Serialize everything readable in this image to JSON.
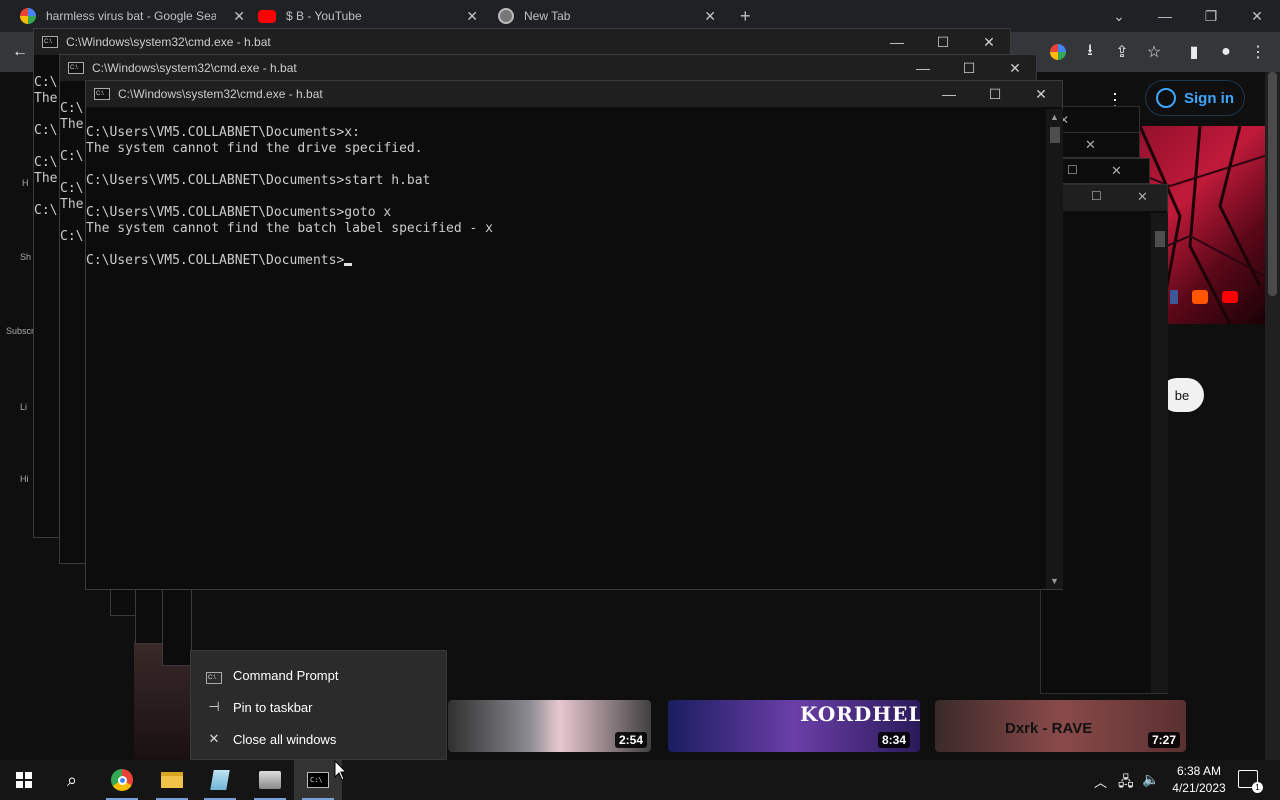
{
  "chrome": {
    "tabs": [
      {
        "title": "harmless virus bat - Google Sear"
      },
      {
        "title": "$ B - YouTube"
      },
      {
        "title": "New Tab"
      }
    ],
    "new_tab_label": "+",
    "signin_label": "Sign in",
    "subscribe_label": "be"
  },
  "youtube": {
    "sidebar_labels": [
      "H",
      "Sh",
      "Subscr",
      "Li",
      "Hi"
    ],
    "videos": [
      {
        "duration": "2:54"
      },
      {
        "duration": "8:34",
        "art_text": "KORDHELL"
      },
      {
        "duration": "7:27",
        "art_text": "Dxrk - RAVE"
      }
    ]
  },
  "cmd_windows": {
    "back2": {
      "title": "C:\\Windows\\system32\\cmd.exe - h.bat",
      "lines": [
        "",
        "C:\\",
        "The",
        "",
        "C:\\",
        "",
        "C:\\",
        "The",
        "",
        "C:\\"
      ]
    },
    "back1": {
      "title": "C:\\Windows\\system32\\cmd.exe - h.bat",
      "lines": [
        "",
        "C:\\",
        "The",
        "",
        "C:\\",
        "",
        "C:\\",
        "The",
        "",
        "C:\\"
      ]
    },
    "front": {
      "title": "C:\\Windows\\system32\\cmd.exe - h.bat",
      "lines": [
        "",
        "C:\\Users\\VM5.COLLABNET\\Documents>x:",
        "The system cannot find the drive specified.",
        "",
        "C:\\Users\\VM5.COLLABNET\\Documents>start h.bat",
        "",
        "C:\\Users\\VM5.COLLABNET\\Documents>goto x",
        "The system cannot find the batch label specified - x",
        "",
        "C:\\Users\\VM5.COLLABNET\\Documents>"
      ]
    }
  },
  "jumplist": {
    "items": [
      {
        "label": "Command Prompt",
        "icon": "cmd-icon"
      },
      {
        "label": "Pin to taskbar",
        "icon": "pin-icon"
      },
      {
        "label": "Close all windows",
        "icon": "close-icon"
      }
    ]
  },
  "taskbar": {
    "time": "6:38 AM",
    "date": "4/21/2023",
    "notification_count": "1",
    "apps": [
      "windows-start",
      "search",
      "chrome",
      "file-explorer",
      "notepad",
      "control-panel",
      "command-prompt"
    ]
  },
  "colors": {
    "chrome_bg": "#202124",
    "youtube_bg": "#0f0f0f",
    "cmd_bg": "#0c0c0c",
    "cmd_text": "#cccccc",
    "signin_blue": "#3ea6ff",
    "taskbar_bg": "#151515"
  }
}
